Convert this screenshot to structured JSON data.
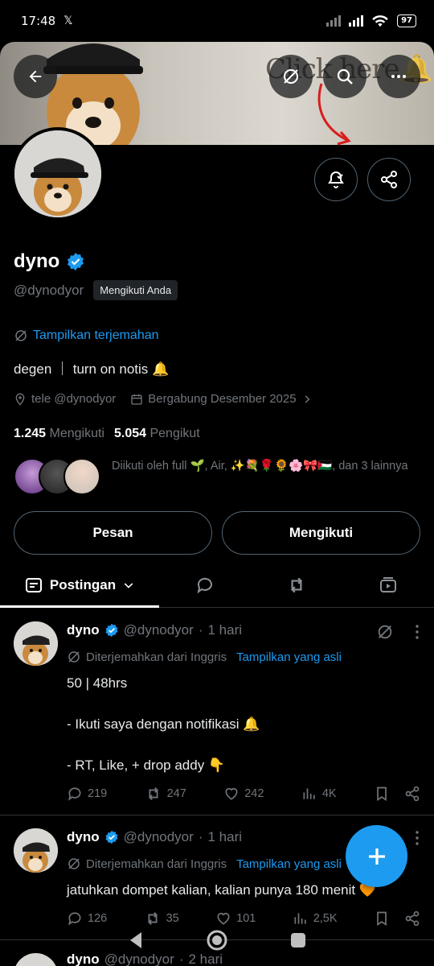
{
  "status_bar": {
    "time": "17:48",
    "x_glyph": "𝕏",
    "battery": "97"
  },
  "banner": {
    "overlay_text": "Click here",
    "overlay_emoji": "🔔"
  },
  "profile": {
    "name": "dyno",
    "handle": "@dynodyor",
    "follows_you_badge": "Mengikuti Anda",
    "translate_link": "Tampilkan terjemahan",
    "bio": "degen ｜ turn on notis 🔔",
    "location": "tele @dynodyor",
    "joined": "Bergabung Desember 2025",
    "following_count": "1.245",
    "following_label": "Mengikuti",
    "followers_count": "5.054",
    "followers_label": "Pengikut",
    "followed_by": "Diikuti oleh full 🌱, Air, ✨💐🌹🌻🌸🎀🇵🇸, dan 3 lainnya"
  },
  "buttons": {
    "message": "Pesan",
    "following": "Mengikuti"
  },
  "tabs": {
    "active": "Postingan"
  },
  "posts": [
    {
      "name": "dyno",
      "handle": "@dynodyor",
      "dot": "·",
      "time": "1 hari",
      "translated_from": "Diterjemahkan dari Inggris",
      "show_original": "Tampilkan yang asli",
      "lines": [
        "50 | 48hrs",
        "",
        "- Ikuti saya dengan notifikasi 🔔",
        "",
        "- RT, Like, + drop addy 👇"
      ],
      "replies": "219",
      "reposts": "247",
      "likes": "242",
      "views": "4K"
    },
    {
      "name": "dyno",
      "handle": "@dynodyor",
      "dot": "·",
      "time": "1 hari",
      "translated_from": "Diterjemahkan dari Inggris",
      "show_original": "Tampilkan yang asli",
      "lines": [
        "jatuhkan dompet kalian, kalian punya 180 menit 🧡"
      ],
      "replies": "126",
      "reposts": "35",
      "likes": "101",
      "views": "2,5K"
    },
    {
      "name": "dyno",
      "handle": "@dynodyor",
      "dot": "·",
      "time": "2 hari"
    }
  ],
  "colors": {
    "accent": "#1d9bf0",
    "background": "#000000",
    "muted": "#71767b",
    "border": "#2f3336"
  }
}
